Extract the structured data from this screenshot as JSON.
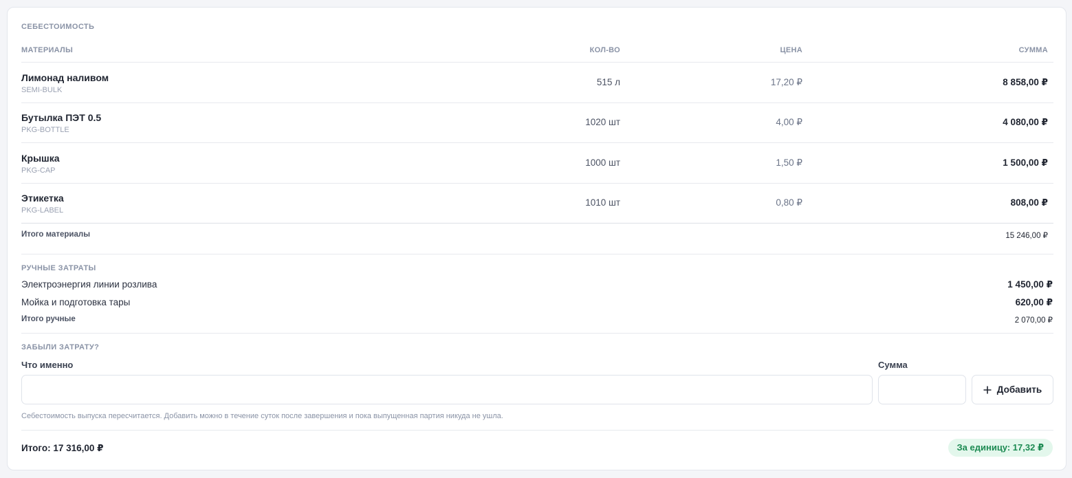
{
  "cost": {
    "title": "СЕБЕСТОИМОСТЬ",
    "columns": {
      "materials": "МАТЕРИАЛЫ",
      "qty": "КОЛ-ВО",
      "price": "ЦЕНА",
      "sum": "СУММА"
    },
    "materials": [
      {
        "name": "Лимонад наливом",
        "sku": "SEMI-BULK",
        "qty": "515 л",
        "price": "17,20 ₽",
        "sum": "8 858,00 ₽"
      },
      {
        "name": "Бутылка ПЭТ 0.5",
        "sku": "PKG-BOTTLE",
        "qty": "1020 шт",
        "price": "4,00 ₽",
        "sum": "4 080,00 ₽"
      },
      {
        "name": "Крышка",
        "sku": "PKG-CAP",
        "qty": "1000 шт",
        "price": "1,50 ₽",
        "sum": "1 500,00 ₽"
      },
      {
        "name": "Этикетка",
        "sku": "PKG-LABEL",
        "qty": "1010 шт",
        "price": "0,80 ₽",
        "sum": "808,00 ₽"
      }
    ],
    "materials_total": {
      "label": "Итого материалы",
      "value": "15 246,00 ₽"
    },
    "manual": {
      "title": "РУЧНЫЕ ЗАТРАТЫ",
      "items": [
        {
          "label": "Электроэнергия линии розлива",
          "value": "1 450,00 ₽"
        },
        {
          "label": "Мойка и подготовка тары",
          "value": "620,00 ₽"
        }
      ],
      "total": {
        "label": "Итого ручные",
        "value": "2 070,00 ₽"
      }
    },
    "forgot": {
      "title": "ЗАБЫЛИ ЗАТРАТУ?",
      "what_label": "Что именно",
      "what_value": "",
      "what_placeholder": "",
      "sum_label": "Сумма",
      "sum_value": "",
      "sum_placeholder": "",
      "add_label": "Добавить",
      "add_icon": "plus-icon",
      "hint": "Себестоимость выпуска пересчитается. Добавить можно в течение суток после завершения и пока выпущенная партия никуда не ушла."
    },
    "total": "Итого: 17 316,00 ₽",
    "per_unit": "За единицу: 17,32 ₽"
  },
  "colors": {
    "accent_green": "#1c8a52",
    "accent_green_bg": "#e3f7ec"
  }
}
